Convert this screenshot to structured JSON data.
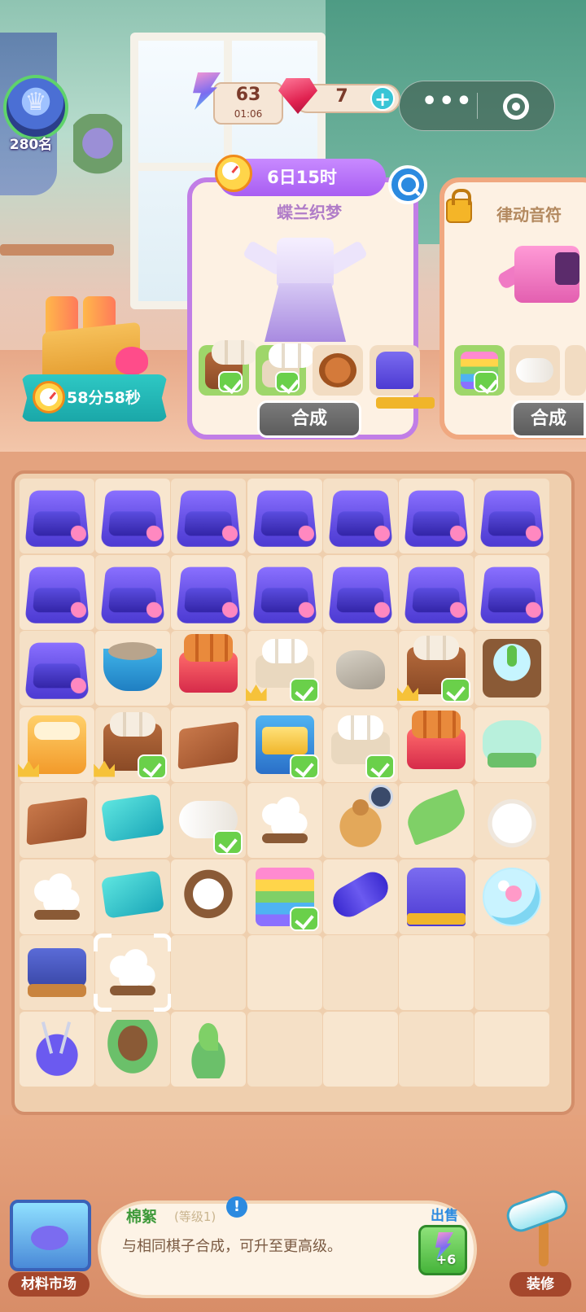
{
  "hud": {
    "rank": "280名",
    "energy_count": "63",
    "energy_timer": "01:06",
    "gem_count": "7",
    "add_label": "+",
    "more_label": "•••"
  },
  "gift": {
    "timer": "58分58秒"
  },
  "orders": [
    {
      "timer": "6日15时",
      "title": "蝶兰织梦",
      "requirements": [
        {
          "icon": "bag-icon",
          "done": true
        },
        {
          "icon": "towels-icon",
          "done": true
        },
        {
          "icon": "leather-icon",
          "done": false
        },
        {
          "icon": "sewing-machine-icon",
          "done": false
        }
      ],
      "button": "合成"
    },
    {
      "title": "律动音符",
      "locked": true,
      "requirements": [
        {
          "icon": "rainbow-fabric-icon",
          "done": true
        },
        {
          "icon": "roll-icon",
          "done": false
        },
        {
          "icon": "towels-icon",
          "done": false
        }
      ],
      "button": "合成"
    }
  ],
  "board": {
    "rows": [
      [
        "kit",
        "kit",
        "kit",
        "kit",
        "kit",
        "kit",
        "kit"
      ],
      [
        "kit",
        "kit",
        "kit",
        "kit",
        "kit",
        "kit",
        "kit"
      ],
      [
        "kit",
        "basin",
        "cocoon-box",
        "towels",
        "rock",
        "bag",
        "terrarium"
      ],
      [
        "machine",
        "bag",
        "leather",
        "gold-box",
        "towels",
        "cocoon-box",
        "fiber-tray"
      ],
      [
        "leather",
        "teal-cloth",
        "roll",
        "cotton",
        "sack",
        "leaf",
        "fluff"
      ],
      [
        "cotton",
        "teal-cloth",
        "cotton-plate",
        "rainbow",
        "thread",
        "sewing-machine",
        "bubble"
      ],
      [
        "spinner",
        "cotton",
        "",
        "",
        "",
        "",
        ""
      ],
      [
        "pincushion",
        "pot",
        "sprout",
        "",
        "",
        "",
        ""
      ]
    ],
    "checks": [
      [
        2,
        3
      ],
      [
        2,
        5
      ],
      [
        3,
        1
      ],
      [
        3,
        3
      ],
      [
        3,
        4
      ],
      [
        4,
        2
      ],
      [
        5,
        3
      ]
    ],
    "crowns": [
      [
        2,
        3
      ],
      [
        2,
        5
      ],
      [
        3,
        0
      ],
      [
        3,
        1
      ]
    ],
    "selected": [
      6,
      1
    ],
    "timer_badge": [
      4,
      4
    ]
  },
  "info": {
    "name": "棉絮",
    "level": "(等级1)",
    "alert": "!",
    "description": "与相同棋子合成，可升至更高级。",
    "sell_label": "出售",
    "sell_amount": "+6"
  },
  "bottom": {
    "market_label": "材料市场",
    "decor_label": "装修"
  }
}
